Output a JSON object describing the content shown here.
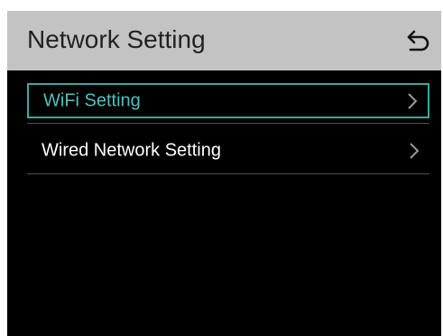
{
  "header": {
    "title": "Network Setting",
    "back_icon": "back-arrow-icon"
  },
  "menu": {
    "items": [
      {
        "label": "WiFi Setting",
        "icon": "chevron-right-icon",
        "selected": true
      },
      {
        "label": "Wired Network Setting",
        "icon": "chevron-right-icon",
        "selected": false
      }
    ]
  },
  "colors": {
    "header_bg": "#c3c3c3",
    "screen_bg": "#000000",
    "accent": "#4fc1be",
    "text": "#ffffff"
  }
}
